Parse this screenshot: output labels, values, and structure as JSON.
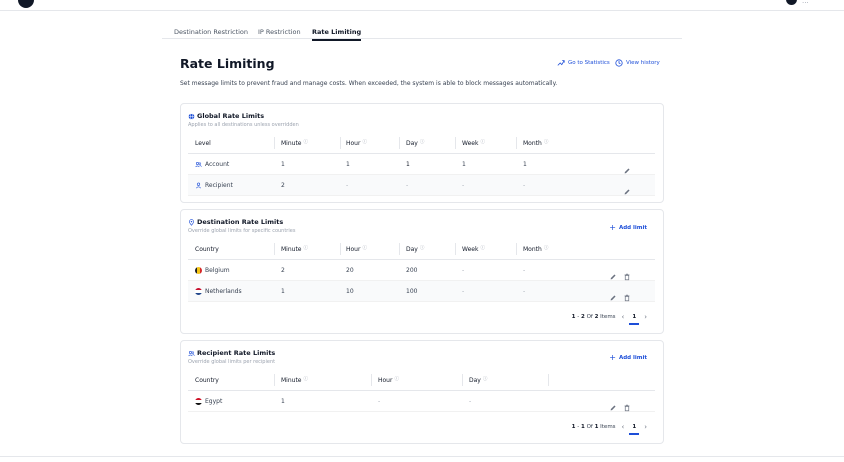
{
  "topbar": {
    "user_label": "..."
  },
  "tabs": [
    {
      "label": "Destination Restriction"
    },
    {
      "label": "IP Restriction"
    },
    {
      "label": "Rate Limiting",
      "active": true
    }
  ],
  "page": {
    "title": "Rate Limiting",
    "go_statistics": "Go to Statistics",
    "view_history": "View history",
    "description": "Set message limits to prevent fraud and manage costs. When exceeded, the system is able to block messages automatically."
  },
  "global": {
    "title": "Global Rate Limits",
    "subtitle": "Applies to all destinations unless overridden",
    "headers": [
      "Level",
      "Minute",
      "Hour",
      "Day",
      "Week",
      "Month"
    ],
    "rows": [
      {
        "level": "Account",
        "minute": "1",
        "hour": "1",
        "day": "1",
        "week": "1",
        "month": "1"
      },
      {
        "level": "Recipient",
        "minute": "2",
        "hour": "-",
        "day": "-",
        "week": "-",
        "month": "-"
      }
    ]
  },
  "destination": {
    "title": "Destination Rate Limits",
    "subtitle": "Override global limits for specific countries",
    "add_label": "Add limit",
    "headers": [
      "Country",
      "Minute",
      "Hour",
      "Day",
      "Week",
      "Month"
    ],
    "rows": [
      {
        "country": "Belgium",
        "minute": "2",
        "hour": "20",
        "day": "200",
        "week": "-",
        "month": "-"
      },
      {
        "country": "Netherlands",
        "minute": "1",
        "hour": "10",
        "day": "100",
        "week": "-",
        "month": "-"
      }
    ],
    "pager": {
      "range_start": "1",
      "range_end": "2",
      "of": "Of",
      "total": "2",
      "items": "Items",
      "current_page": "1"
    }
  },
  "recipient": {
    "title": "Recipient Rate Limits",
    "subtitle": "Override global limits per recipient",
    "add_label": "Add limit",
    "headers": [
      "Country",
      "Minute",
      "Hour",
      "Day"
    ],
    "rows": [
      {
        "country": "Egypt",
        "minute": "1",
        "hour": "-",
        "day": "-"
      }
    ],
    "pager": {
      "range_start": "1",
      "range_end": "1",
      "of": "Of",
      "total": "1",
      "items": "Items",
      "current_page": "1"
    }
  },
  "colors": {
    "accent": "#1d4ed8",
    "text": "#1f2937",
    "muted": "#9ca3af",
    "border": "#e5e7eb",
    "row_alt": "#f9fafb"
  }
}
